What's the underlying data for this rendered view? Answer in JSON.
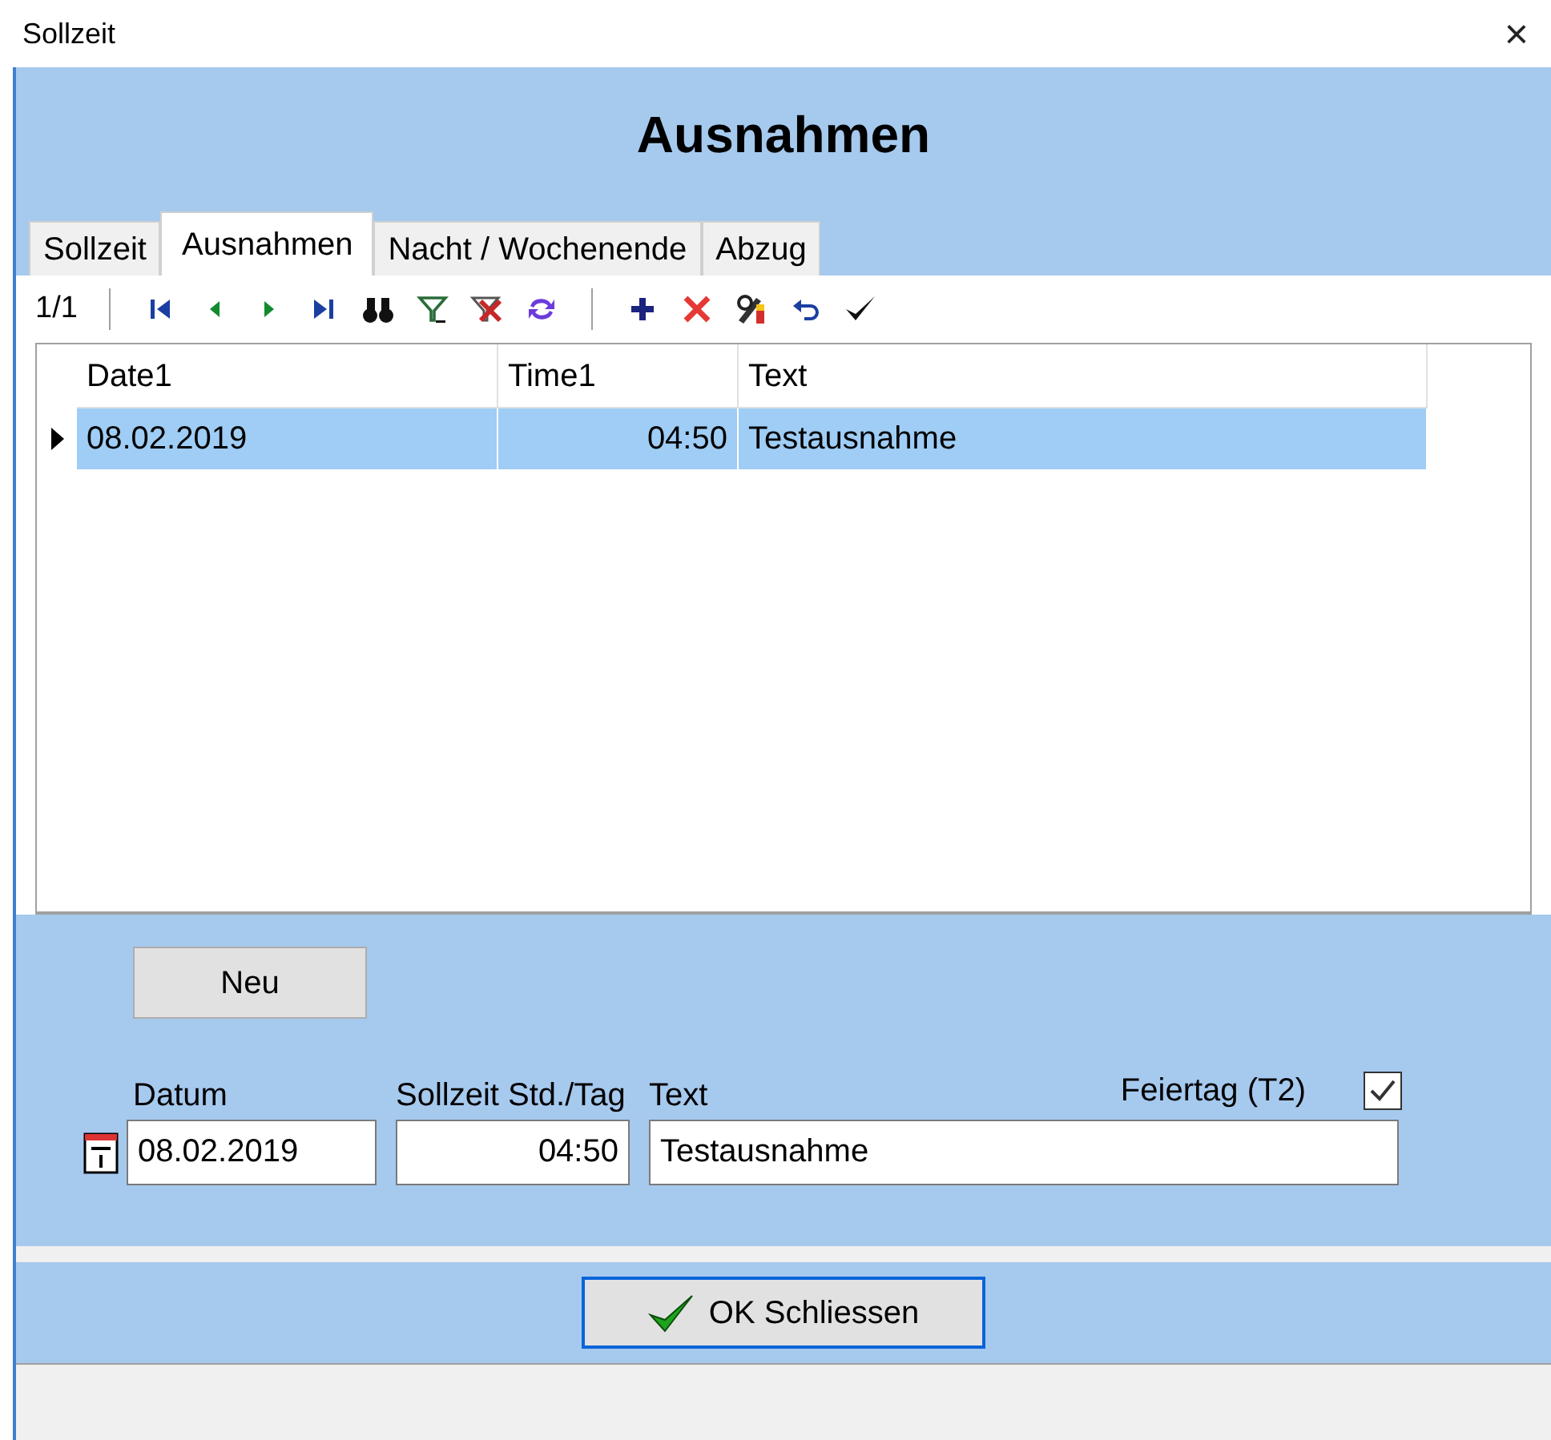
{
  "window": {
    "title": "Sollzeit",
    "close": "×"
  },
  "header": {
    "title": "Ausnahmen"
  },
  "tabs": [
    {
      "label": "Sollzeit",
      "selected": false
    },
    {
      "label": "Ausnahmen",
      "selected": true
    },
    {
      "label": "Nacht / Wochenende",
      "selected": false
    },
    {
      "label": "Abzug",
      "selected": false
    }
  ],
  "toolbar": {
    "record_count": "1/1"
  },
  "table": {
    "columns": [
      "Date1",
      "Time1",
      "Text"
    ],
    "rows": [
      {
        "cells": [
          "08.02.2019",
          "04:50",
          "Testausnahme"
        ],
        "selected": true
      }
    ]
  },
  "form": {
    "new_button": "Neu",
    "fields": [
      {
        "label": "Datum",
        "value": "08.02.2019"
      },
      {
        "label": "Sollzeit Std./Tag",
        "value": "04:50"
      },
      {
        "label": "Text",
        "value": "Testausnahme"
      }
    ],
    "holiday": {
      "label": "Feiertag (T2)",
      "checked": true
    }
  },
  "ok_button": "OK Schliessen"
}
